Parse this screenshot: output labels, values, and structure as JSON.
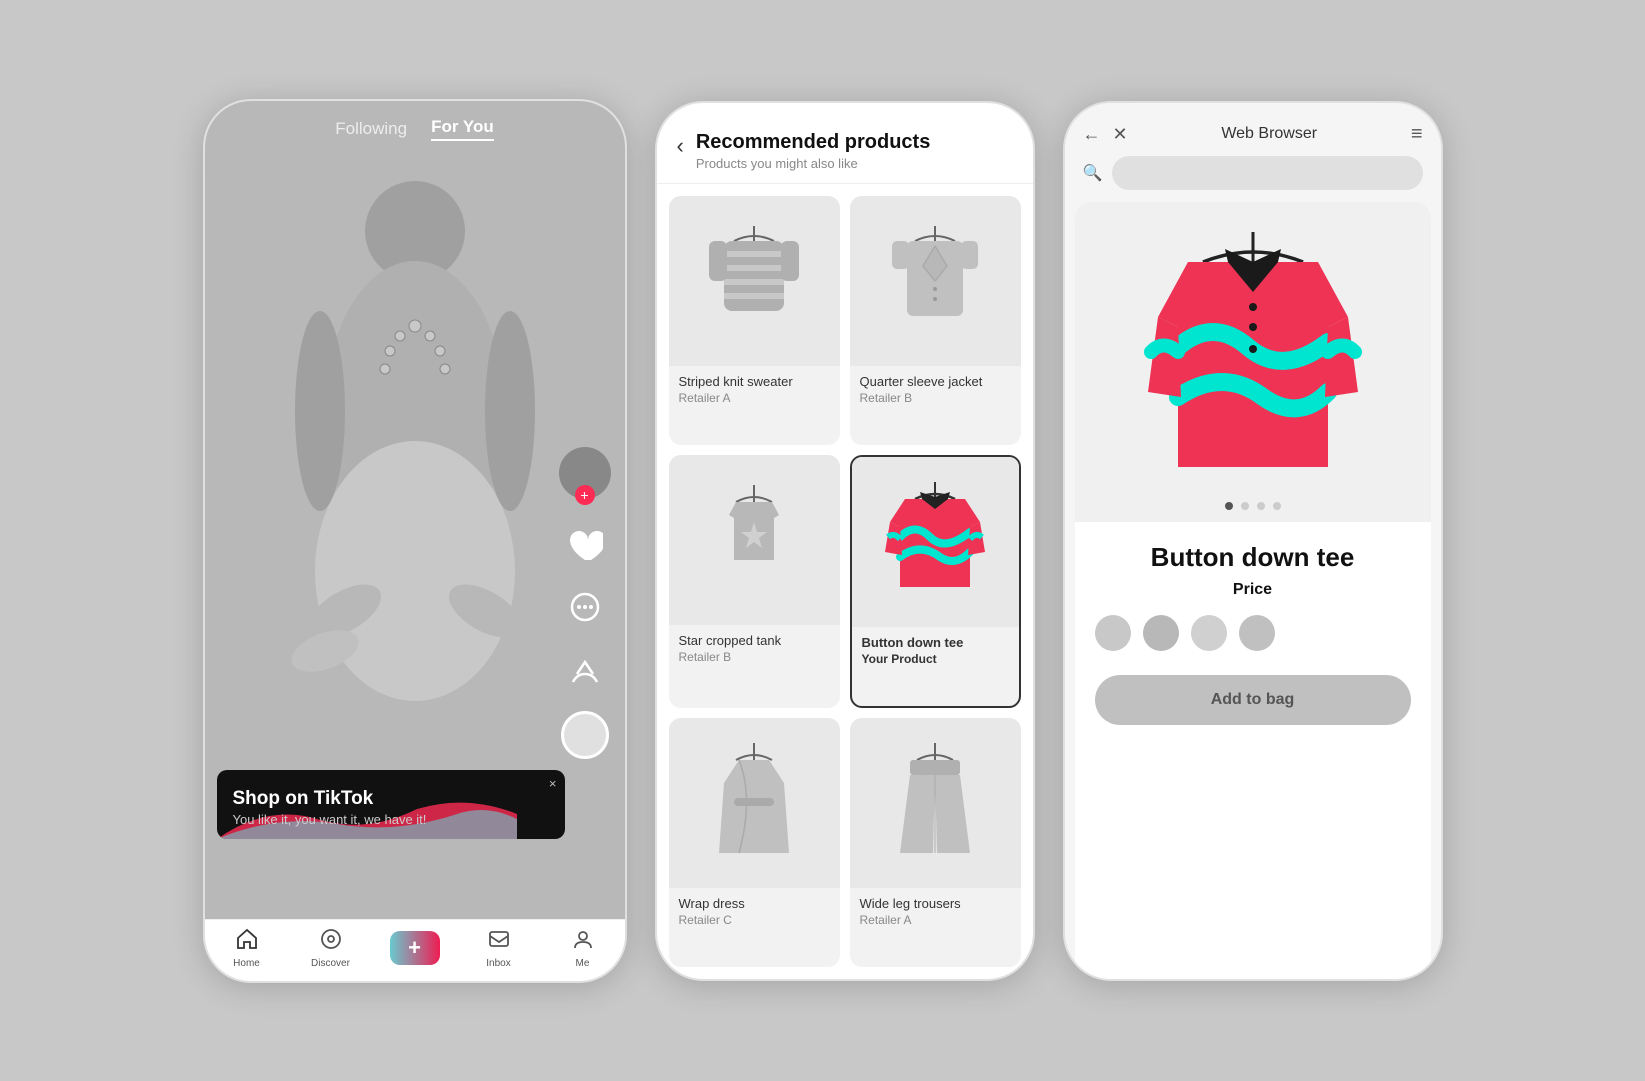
{
  "phone1": {
    "nav": {
      "following_label": "Following",
      "foryou_label": "For You"
    },
    "shop_banner": {
      "title": "Shop on TikTok",
      "subtitle": "You like it, you want it, we have it!",
      "close": "×"
    },
    "bottom_nav": [
      {
        "label": "Home",
        "icon": "🏠"
      },
      {
        "label": "Discover",
        "icon": "🔍"
      },
      {
        "label": "+",
        "icon": "+"
      },
      {
        "label": "Inbox",
        "icon": "💬"
      },
      {
        "label": "Me",
        "icon": "👤"
      }
    ]
  },
  "phone2": {
    "header": {
      "title": "Recommended products",
      "subtitle": "Products you might also like"
    },
    "products": [
      {
        "name": "Striped knit sweater",
        "retailer": "Retailer A",
        "highlight": false
      },
      {
        "name": "Quarter sleeve jacket",
        "retailer": "Retailer B",
        "highlight": false
      },
      {
        "name": "Star cropped tank",
        "retailer": "Retailer B",
        "highlight": false
      },
      {
        "name": "Button down tee",
        "retailer": "Your Product",
        "highlight": true
      },
      {
        "name": "Wrap dress",
        "retailer": "Retailer C",
        "highlight": false
      },
      {
        "name": "Wide leg trousers",
        "retailer": "Retailer A",
        "highlight": false
      }
    ]
  },
  "phone3": {
    "header": {
      "title": "Web Browser"
    },
    "product": {
      "name": "Button down tee",
      "price_label": "Price",
      "add_to_bag": "Add to bag"
    },
    "carousel": {
      "active_dot": 0,
      "total_dots": 4
    }
  }
}
